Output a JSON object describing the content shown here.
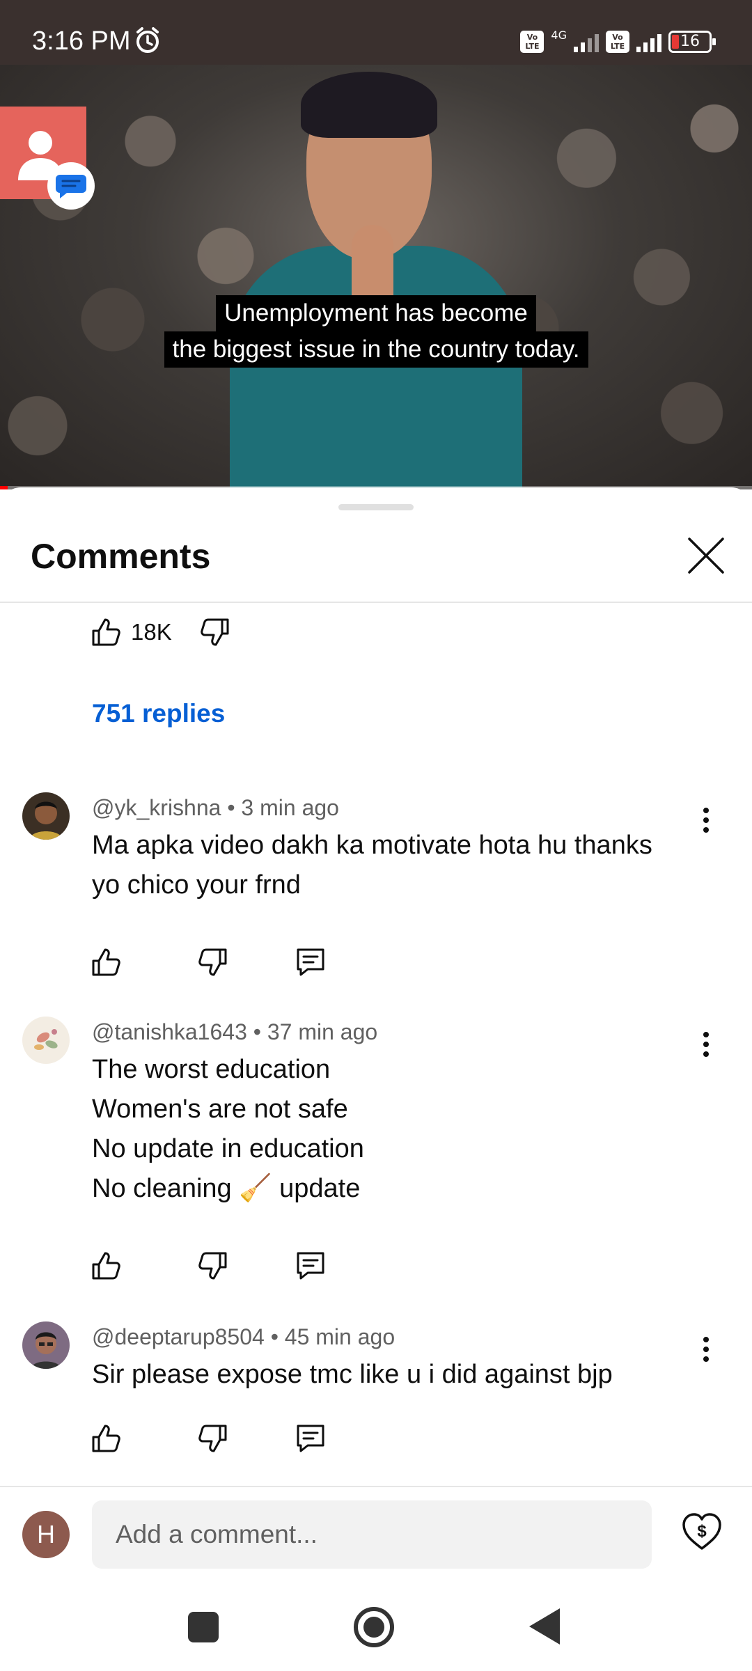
{
  "status_bar": {
    "time": "3:16 PM",
    "network_label": "4G",
    "sim1_label": "Vo LTE",
    "sim2_label": "Vo LTE",
    "battery": "16"
  },
  "video": {
    "caption_line1": "Unemployment has become",
    "caption_line2": "the biggest issue in the country today.",
    "progress_fraction": 0.01
  },
  "sheet": {
    "title": "Comments",
    "close_icon": "close-icon"
  },
  "top_comment_tail": {
    "like_count": "18K",
    "replies_label": "751 replies"
  },
  "comments": [
    {
      "author": "@yk_krishna",
      "separator": " • ",
      "time": "3 min ago",
      "lines": [
        "Ma apka video dakh ka motivate hota hu thanks",
        "yo chico your frnd"
      ]
    },
    {
      "author": "@tanishka1643",
      "separator": " • ",
      "time": "37 min ago",
      "lines": [
        "The worst education",
        "Women's are not safe",
        "No update in education",
        "No cleaning 🧹 update"
      ]
    },
    {
      "author": "@deeptarup8504",
      "separator": " • ",
      "time": "45 min ago",
      "lines": [
        "Sir please expose tmc like u i did against bjp"
      ]
    }
  ],
  "composer": {
    "avatar_letter": "H",
    "placeholder": "Add a comment..."
  },
  "colors": {
    "link_blue": "#065fd4",
    "progress_red": "#ff0000",
    "contact_badge": "#e5645c"
  }
}
